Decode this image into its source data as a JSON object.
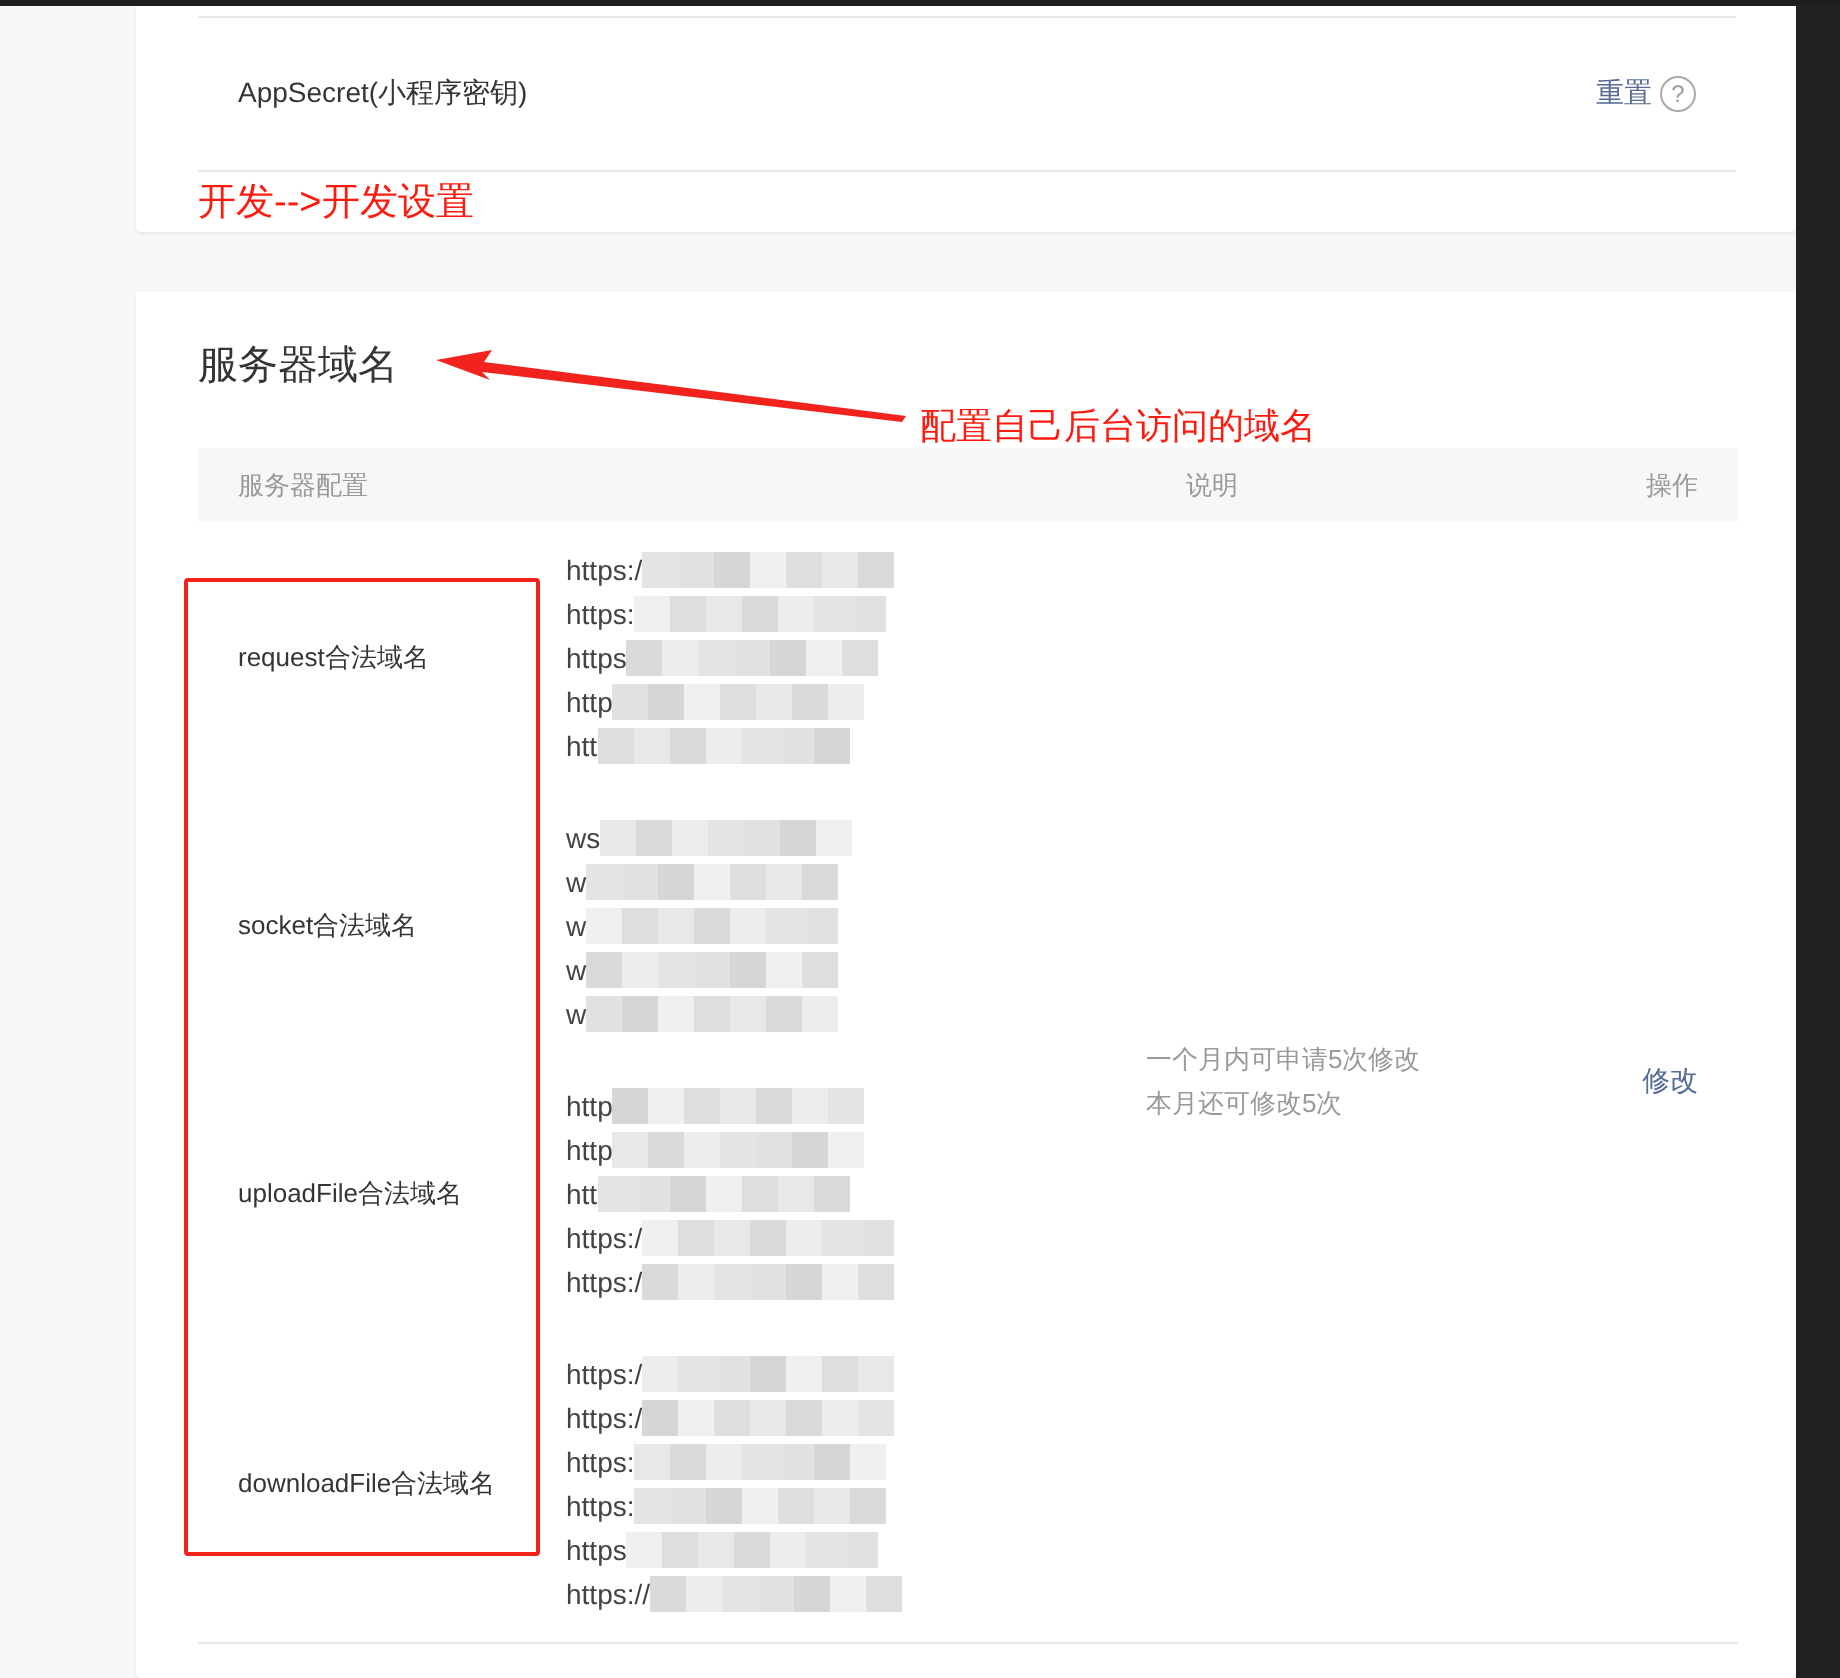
{
  "app_secret_row": {
    "label": "AppSecret(小程序密钥)",
    "action": "重置",
    "help": "?"
  },
  "annotation_note": "开发-->开发设置",
  "server_domains": {
    "title": "服务器域名",
    "columns": [
      "服务器配置",
      "说明",
      "操作"
    ],
    "groups": [
      {
        "label": "request合法域名",
        "urls": [
          "https:/",
          "https:",
          "https",
          "http",
          "htt"
        ]
      },
      {
        "label": "socket合法域名",
        "urls": [
          "ws",
          "w",
          "w",
          "w",
          "w"
        ]
      },
      {
        "label": "uploadFile合法域名",
        "urls": [
          "http",
          "http",
          "htt",
          "https:/",
          "https:/"
        ]
      },
      {
        "label": "downloadFile合法域名",
        "urls": [
          "https:/",
          "https:/",
          "https:",
          "https:",
          "https",
          "https://"
        ]
      }
    ],
    "description": [
      "一个月内可申请5次修改",
      "本月还可修改5次"
    ],
    "action": "修改"
  },
  "arrow_annotation": "配置自己后台访问的域名"
}
